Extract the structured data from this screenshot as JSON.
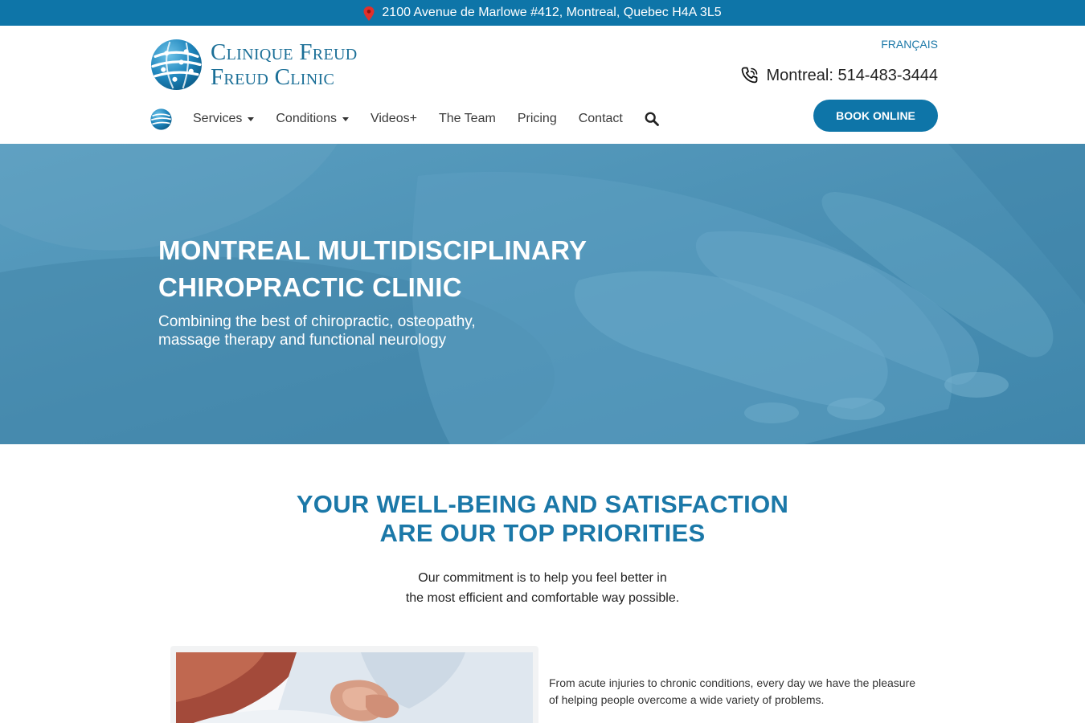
{
  "topbar": {
    "address": "2100 Avenue de Marlowe #412, Montreal, Quebec H4A 3L5",
    "pin_icon": "map-pin-icon",
    "pin_color": "#e0302c",
    "bg_color": "#0e75a8"
  },
  "header": {
    "logo_line1": "Clinique Freud",
    "logo_line2": "Freud Clinic",
    "language_link": "FRANÇAIS",
    "phone": "Montreal: 514-483-3444",
    "phone_icon": "phone-icon",
    "book_button": "BOOK ONLINE"
  },
  "nav": {
    "items": [
      {
        "label": "Services",
        "dropdown": true
      },
      {
        "label": "Conditions",
        "dropdown": true
      },
      {
        "label": "Videos+",
        "dropdown": false
      },
      {
        "label": "The Team",
        "dropdown": false
      },
      {
        "label": "Pricing",
        "dropdown": false
      },
      {
        "label": "Contact",
        "dropdown": false
      }
    ],
    "search_icon": "search-icon"
  },
  "hero": {
    "title_line1": "MONTREAL MULTIDISCIPLINARY",
    "title_line2": "CHIROPRACTIC CLINIC",
    "subtitle_line1": "Combining the best of chiropractic, osteopathy,",
    "subtitle_line2": "massage therapy and functional neurology"
  },
  "priorities": {
    "heading_line1": "YOUR WELL-BEING AND SATISFACTION",
    "heading_line2": "ARE OUR TOP PRIORITIES",
    "text_line1": "Our commitment is to help you feel better in",
    "text_line2": "the most efficient and comfortable way possible."
  },
  "intro": {
    "line1": "From acute injuries to chronic conditions, every day we have the pleasure",
    "line2": "of helping people overcome a wide variety of problems."
  },
  "colors": {
    "brand": "#0e75a8",
    "heading": "#1b78a8"
  }
}
